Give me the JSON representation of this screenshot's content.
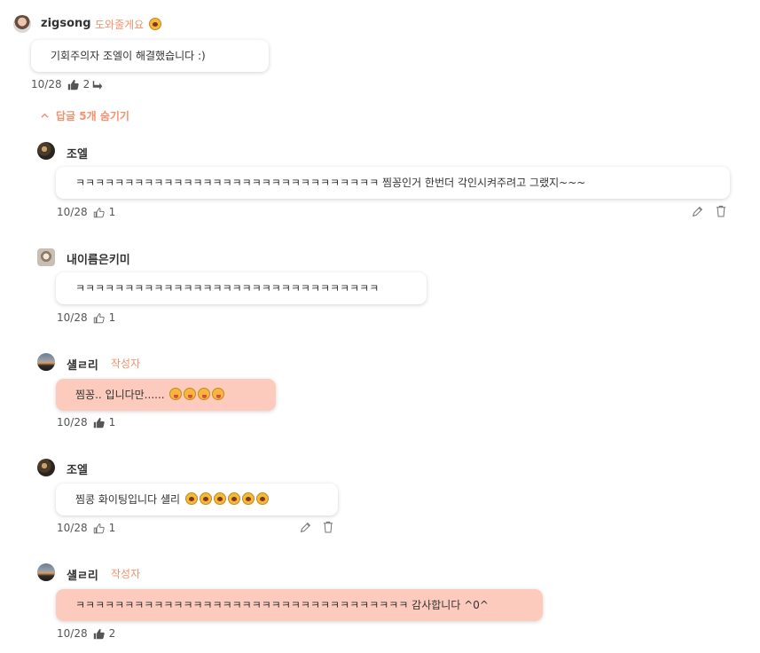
{
  "main_comment": {
    "author": "zigsong",
    "tag": "도와줄게요",
    "text": "기회주의자 조엘이 해결했습니다 :)",
    "date": "10/28",
    "likes": "2"
  },
  "replies_toggle": {
    "label": "답글 5개 숨기기"
  },
  "replies": [
    {
      "author": "조엘",
      "tag": "",
      "text": "ㅋㅋㅋㅋㅋㅋㅋㅋㅋㅋㅋㅋㅋㅋㅋㅋㅋㅋㅋㅋㅋㅋㅋㅋㅋㅋㅋㅋㅋㅋㅋ 찜꽁인거 한번더 각인시켜주려고 그랬지~~~",
      "date": "10/28",
      "likes": "1"
    },
    {
      "author": "내이름은키미",
      "tag": "",
      "text": "ㅋㅋㅋㅋㅋㅋㅋㅋㅋㅋㅋㅋㅋㅋㅋㅋㅋㅋㅋㅋㅋㅋㅋㅋㅋㅋㅋㅋㅋㅋㅋ",
      "date": "10/28",
      "likes": "1"
    },
    {
      "author": "섈ㄹ리",
      "tag": "작성자",
      "text": "찜꽁.. 입니다만......",
      "date": "10/28",
      "likes": "1"
    },
    {
      "author": "조엘",
      "tag": "",
      "text": "찜콩 화이팅입니다 섈리",
      "date": "10/28",
      "likes": "1"
    },
    {
      "author": "섈ㄹ리",
      "tag": "작성자",
      "text": "ㅋㅋㅋㅋㅋㅋㅋㅋㅋㅋㅋㅋㅋㅋㅋㅋㅋㅋㅋㅋㅋㅋㅋㅋㅋㅋㅋㅋㅋㅋㅋㅋㅋㅋ 감사합니다 ^0^",
      "date": "10/28",
      "likes": "2"
    }
  ],
  "icons": {
    "like": "thumbs-up-icon",
    "reply": "reply-arrow-icon",
    "edit": "pencil-icon",
    "delete": "trash-icon",
    "toggle": "chevron-up-icon"
  },
  "colors": {
    "accent": "#f4916c",
    "author_bubble": "#fdcbbd"
  }
}
